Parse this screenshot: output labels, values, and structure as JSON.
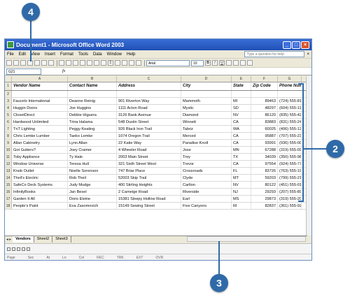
{
  "window": {
    "title": "Document1 - Microsoft Office Word 2003",
    "help_placeholder": "Type a question for help"
  },
  "menu": [
    "File",
    "Edit",
    "View",
    "Insert",
    "Format",
    "Tools",
    "Data",
    "Window",
    "Help"
  ],
  "toolbar": {
    "font": "Arial",
    "size": "10",
    "bold": "B",
    "italic": "I",
    "underline": "U"
  },
  "formula_bar": {
    "name_box": "G21",
    "fx": "fx"
  },
  "columns": [
    "A",
    "B",
    "C",
    "D",
    "E",
    "F",
    "G"
  ],
  "headers": [
    "Vendor Name",
    "Contact Name",
    "Address",
    "City",
    "State",
    "Zip Code",
    "Phone Number"
  ],
  "rows": [
    [
      "",
      "",
      "",
      "",
      "",
      "",
      ""
    ],
    [
      "Faucets International",
      "Deanne Reinig",
      "901 Riverton Way",
      "Mammoth",
      "MI",
      "89463",
      "(724) 555-8123"
    ],
    [
      "Huggin Doors",
      "Joe Huggins",
      "1111 Acton Road",
      "Mystic",
      "SD",
      "48297",
      "(604) 555-1162"
    ],
    [
      "ClosetDirect",
      "Debbie Higuera",
      "3126 Bank Avenue",
      "Diamond",
      "NV",
      "86120",
      "(835) 555-4243"
    ],
    [
      "Hardwood Unlimited",
      "Trina Halama",
      "548 Dustin Street",
      "Winnett",
      "CA",
      "83883",
      "(831) 555-2487"
    ],
    [
      "TnT Lighting",
      "Peggy Keating",
      "926 Black Iron Trail",
      "Tabriz",
      "WA",
      "60025",
      "(406) 555-1208"
    ],
    [
      "Chris Lemke Lumber",
      "Taeko Lemke",
      "1074 Oregon Trail",
      "Merced",
      "CA",
      "95887",
      "(707) 555-2328"
    ],
    [
      "Allan Cabinetry",
      "Lynn Allan",
      "22 Katie Way",
      "Paradise Knoll",
      "CA",
      "93991",
      "(936) 555-0077"
    ],
    [
      "Got Gutters?",
      "Joey Cramer",
      "4 Wheeler Road",
      "Jose",
      "MN",
      "67288",
      "(319) 555-0987"
    ],
    [
      "Toby Appliance",
      "Ty Hale",
      "2003 Main Street",
      "Trey",
      "TX",
      "34039",
      "(350) 555-9874"
    ],
    [
      "Window Universe",
      "Teresa Hull",
      "321 Sixth Street West",
      "Trevor",
      "CA",
      "97554",
      "(924) 555-7745"
    ],
    [
      "Knob Outlet",
      "Noelle Sorenson",
      "747 Briar Place",
      "Crossroads",
      "FL",
      "83726",
      "(763) 555-1928"
    ],
    [
      "Theil's Electric",
      "Rob Theil",
      "52003 Skip Trail",
      "Clyde",
      "MT",
      "59203",
      "(799) 555-2117"
    ],
    [
      "SafeCo Deck Systems",
      "Judy Mudge",
      "400 Stirling Heights",
      "Carlton",
      "NV",
      "80122",
      "(451) 555-0187"
    ],
    [
      "InfinityBooks",
      "Jan Besel",
      "2 Carneige Road",
      "Riverside",
      "NJ",
      "29293",
      "(207) 555-8922"
    ],
    [
      "Garden It All",
      "Doris Eleine",
      "15381 Sleepy Hollow Road",
      "Earl",
      "MS",
      "29873",
      "(319) 555-2001"
    ],
    [
      "People's Paint",
      "Eva Zasomovich",
      "15149 Sewing Street",
      "Five Canyons",
      "RI",
      "82837",
      "(361) 555-9283"
    ]
  ],
  "row_numbers": [
    "1",
    "2",
    "3",
    "4",
    "5",
    "6",
    "7",
    "8",
    "9",
    "10",
    "11",
    "12",
    "13",
    "14",
    "15",
    "16",
    "17",
    "18"
  ],
  "sheet_tabs": [
    "Vendors",
    "Sheet2",
    "Sheet3"
  ],
  "status": [
    "Page",
    "Sec",
    "At",
    "Ln",
    "Col",
    "REC",
    "TRK",
    "EXT",
    "OVR"
  ],
  "callouts": [
    "4",
    "2",
    "3"
  ]
}
